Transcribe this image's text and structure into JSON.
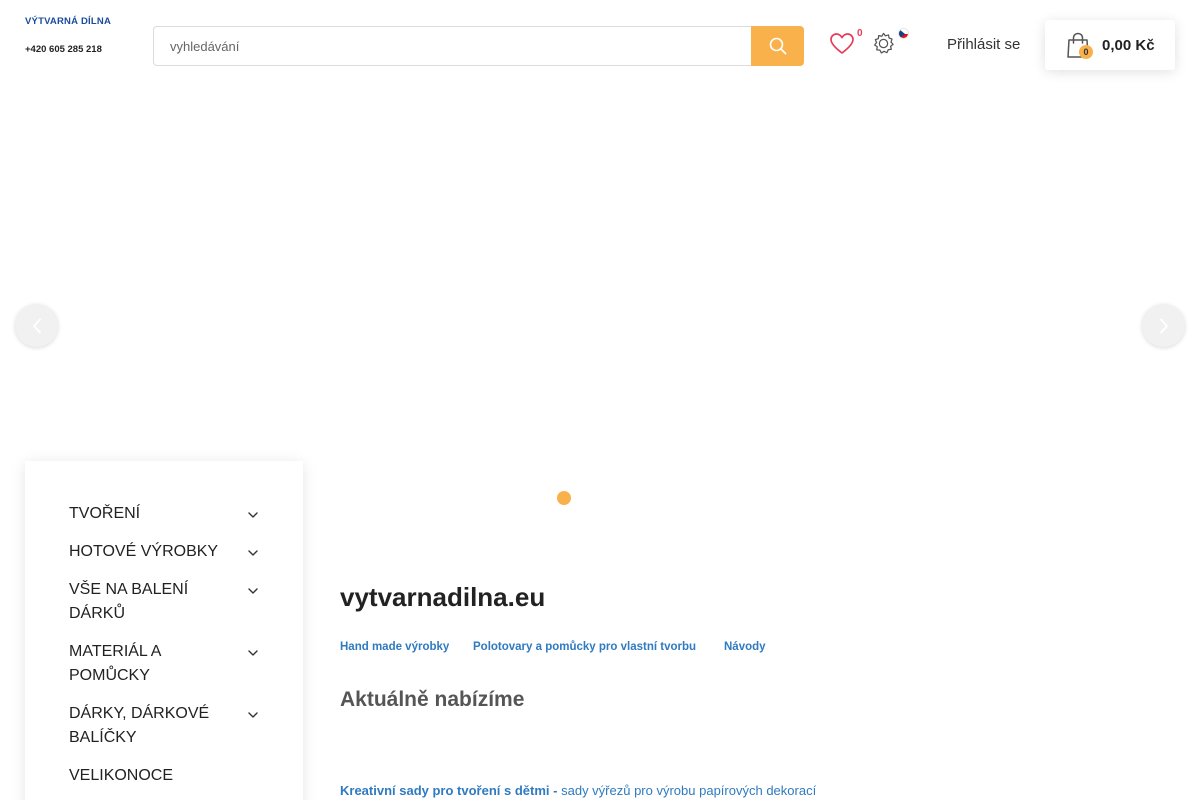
{
  "header": {
    "logo_name": "VÝTVARNÁ DÍLNA",
    "phone": "+420 605 285 218",
    "search_placeholder": "vyhledávání",
    "wishlist_count": "0",
    "login_label": "Přihlásit se",
    "cart_count": "0",
    "cart_total": "0,00 Kč",
    "language": "cs"
  },
  "sidebar": {
    "items": [
      {
        "label": "TVOŘENÍ"
      },
      {
        "label": "HOTOVÉ VÝROBKY"
      },
      {
        "label": "VŠE NA BALENÍ DÁRKŮ"
      },
      {
        "label": "MATERIÁL A POMŮCKY"
      },
      {
        "label": "DÁRKY, DÁRKOVÉ BALÍČKY"
      },
      {
        "label": "VELIKONOCE"
      }
    ]
  },
  "main": {
    "site_title": "vytvarnadilna.eu",
    "links": [
      {
        "label": "Hand made výrobky"
      },
      {
        "label": "Polotovary a pomůcky pro vlastní tvorbu"
      },
      {
        "label": "Návody"
      }
    ],
    "offer_title": "Aktuálně nabízíme",
    "promo_strong": "Kreativní sady pro tvoření s dětmi",
    "promo_sep": "-",
    "promo_desc": "sady výřezů pro výrobu papírových dekorací"
  },
  "colors": {
    "accent": "#f9b14b",
    "brand_blue": "#1a4b9c",
    "link_blue": "#2f7ac0",
    "wishlist_count": "#e53c5a"
  },
  "icons": [
    "search-icon",
    "heart-icon",
    "gear-icon",
    "flag-cz-icon",
    "shopping-bag-icon",
    "chevron-down-icon",
    "chevron-left-icon",
    "chevron-right-icon"
  ]
}
